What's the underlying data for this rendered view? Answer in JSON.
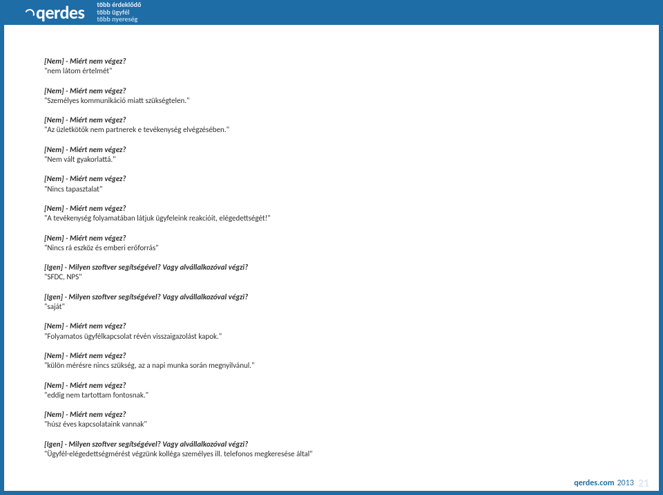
{
  "header": {
    "brand": "qerdes",
    "tagline1": "több érdeklődő",
    "tagline2": "több ügyfél",
    "tagline3": "több nyereség"
  },
  "qa": [
    {
      "question": "[Nem] - Miért nem végez?",
      "answer": "\"nem látom értelmét\""
    },
    {
      "question": "[Nem] - Miért nem végez?",
      "answer": "\"Személyes kommunikáció miatt szükségtelen.\""
    },
    {
      "question": "[Nem] - Miért nem végez?",
      "answer": "\"Az üzletkötők nem partnerek e tevékenység elvégzésében.\""
    },
    {
      "question": "[Nem] - Miért nem végez?",
      "answer": "\"Nem vált gyakorlattá.\""
    },
    {
      "question": "[Nem] - Miért nem végez?",
      "answer": "\"Nincs tapasztalat\""
    },
    {
      "question": "[Nem] - Miért nem végez?",
      "answer": "\"A tevékenység folyamatában látjuk ügyfeleink reakcióit, elégedettségét!\""
    },
    {
      "question": "[Nem] - Miért nem végez?",
      "answer": "\"Nincs rá eszköz és emberi erőforrás\""
    },
    {
      "question": "[Igen] - Milyen szoftver segítségével? Vagy alvállalkozóval végzi?",
      "answer": "\"SFDC, NPS\""
    },
    {
      "question": "[Igen] - Milyen szoftver segítségével? Vagy alvállalkozóval végzi?",
      "answer": "\"saját\""
    },
    {
      "question": "[Nem] - Miért nem végez?",
      "answer": "\"Folyamatos ügyfélkapcsolat révén visszaigazolást kapok.\""
    },
    {
      "question": "[Nem] - Miért nem végez?",
      "answer": "\"külön mérésre nincs szükség, az a napi munka során megnyilvánul.\""
    },
    {
      "question": "[Nem] - Miért nem végez?",
      "answer": "\"eddig nem tartottam fontosnak.\""
    },
    {
      "question": "[Nem] - Miért nem végez?",
      "answer": "\"húsz éves kapcsolataink vannak\""
    },
    {
      "question": "[Igen] - Milyen szoftver segítségével? Vagy alvállalkozóval végzi?",
      "answer": "\"Ügyfél-elégedettségmérést végzünk kolléga személyes ill. telefonos megkeresése által\""
    }
  ],
  "footer": {
    "brand": "qerdes.com",
    "year": "2013",
    "page": "21"
  }
}
